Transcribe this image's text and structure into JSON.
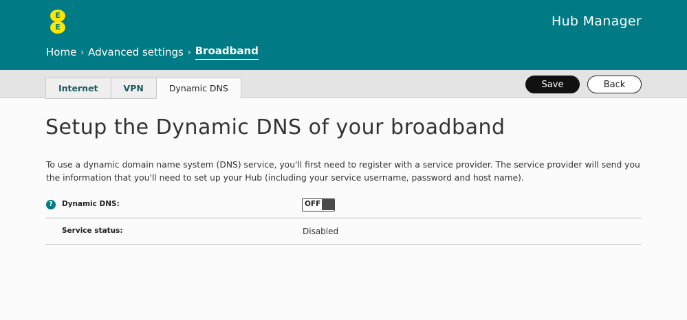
{
  "header": {
    "logo_letters": [
      "E",
      "E"
    ],
    "app_title": "Hub Manager",
    "background_color": "#007b85",
    "logo_color": "#ffe600"
  },
  "breadcrumb": {
    "items": [
      "Home",
      "Advanced settings",
      "Broadband"
    ],
    "separator": "›"
  },
  "tabs": [
    {
      "label": "Internet",
      "active": false
    },
    {
      "label": "VPN",
      "active": false
    },
    {
      "label": "Dynamic DNS",
      "active": true
    }
  ],
  "actions": {
    "save_label": "Save",
    "back_label": "Back"
  },
  "main": {
    "title": "Setup the Dynamic DNS of your broadband",
    "intro": "To use a dynamic domain name system (DNS) service, you'll first need to register with a service provider. The service provider will send you the information that you'll need to set up your Hub (including your service username, password and host name).",
    "help_icon": "question-icon",
    "fields": {
      "dynamic_dns": {
        "label": "Dynamic DNS:",
        "toggle_text": "OFF",
        "state": "off"
      },
      "service_status": {
        "label": "Service status:",
        "value": "Disabled"
      }
    }
  }
}
